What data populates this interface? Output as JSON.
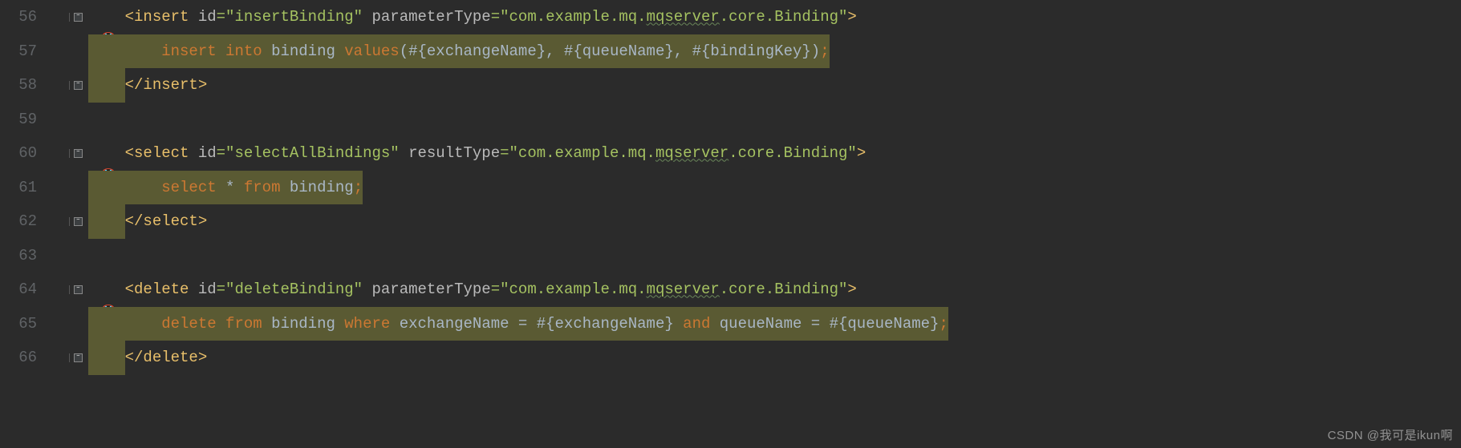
{
  "watermark": "CSDN @我可是ikun啊",
  "lines": {
    "l56": {
      "num": "56",
      "tag_open": "<insert ",
      "attr1": "id",
      "eq": "=",
      "val1": "\"insertBinding\"",
      "attr2": "parameterType",
      "val2a": "\"com.example.mq.",
      "val2b": "mqserver",
      "val2c": ".core.Binding\"",
      "close": ">"
    },
    "l57": {
      "num": "57",
      "kw1": "insert ",
      "kw2": "into ",
      "t1": "binding ",
      "kw3": "values",
      "t2": "(#{exchangeName}, #{queueName}, #{bindingKey})",
      "semi": ";"
    },
    "l58": {
      "num": "58",
      "tag": "</insert>"
    },
    "l59": {
      "num": "59"
    },
    "l60": {
      "num": "60",
      "tag_open": "<select ",
      "attr1": "id",
      "val1": "\"selectAllBindings\"",
      "attr2": "resultType",
      "val2a": "\"com.example.mq.",
      "val2b": "mqserver",
      "val2c": ".core.Binding\"",
      "close": ">"
    },
    "l61": {
      "num": "61",
      "kw1": "select ",
      "t1": "* ",
      "kw2": "from ",
      "t2": "binding",
      "semi": ";"
    },
    "l62": {
      "num": "62",
      "tag": "</select>"
    },
    "l63": {
      "num": "63"
    },
    "l64": {
      "num": "64",
      "tag_open": "<delete ",
      "attr1": "id",
      "val1": "\"deleteBinding\"",
      "attr2": "parameterType",
      "val2a": "\"com.example.mq.",
      "val2b": "mqserver",
      "val2c": ".core.Binding\"",
      "close": ">"
    },
    "l65": {
      "num": "65",
      "kw1": "delete ",
      "kw2": "from ",
      "t1": "binding ",
      "kw3": "where ",
      "t2": "exchangeName = #{exchangeName} ",
      "kw4": "and ",
      "t3": "queueName = #{queueName}",
      "semi": ";"
    },
    "l66": {
      "num": "66",
      "tag": "</delete>"
    }
  }
}
